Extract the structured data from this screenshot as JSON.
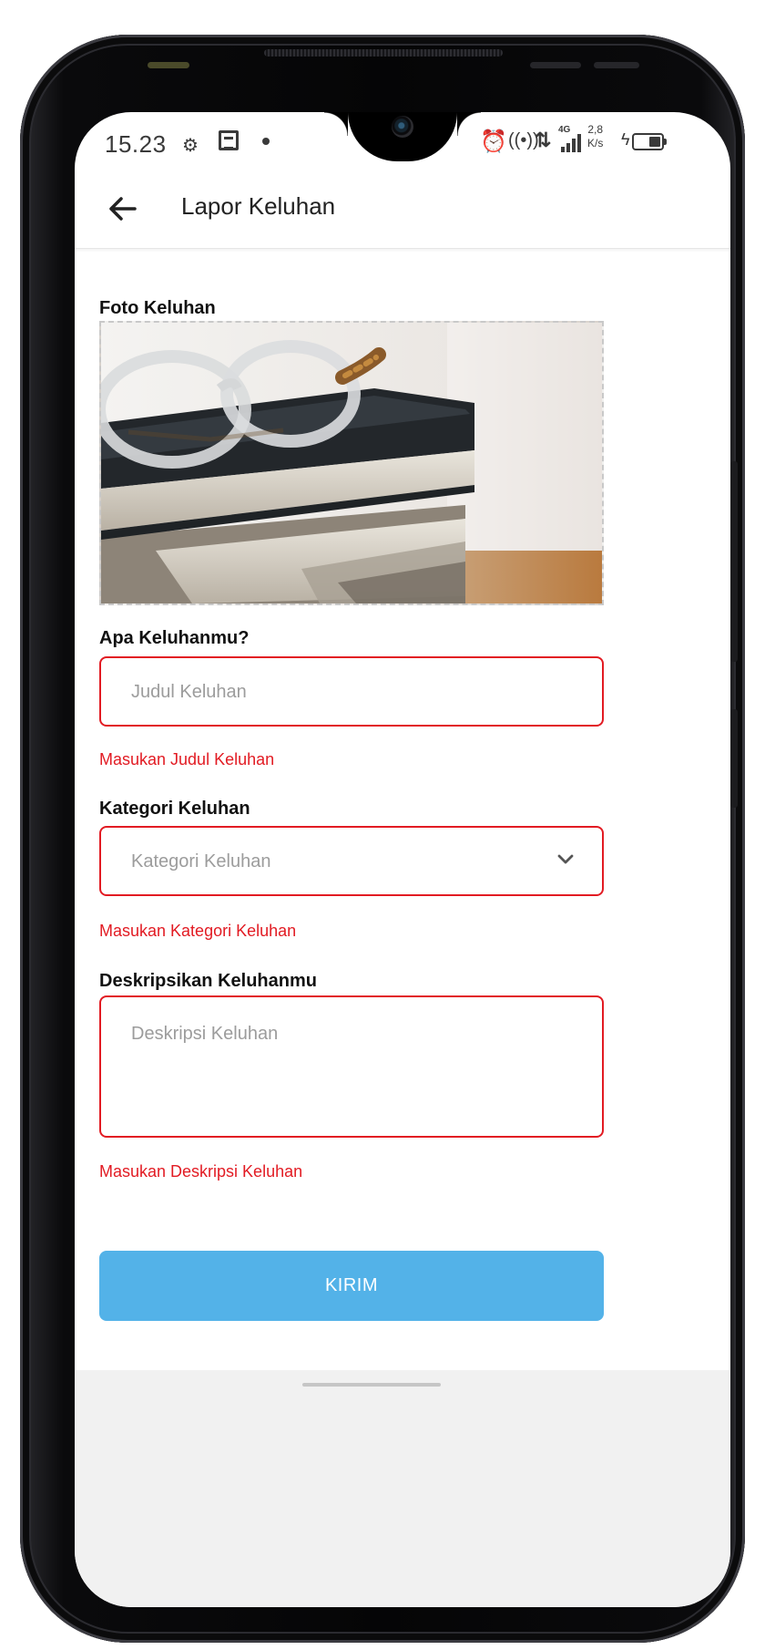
{
  "status_bar": {
    "time": "15.23",
    "network": "4G",
    "speed_value": "2,8",
    "speed_unit": "K/s"
  },
  "header": {
    "title": "Lapor Keluhan"
  },
  "form": {
    "photo": {
      "label": "Foto Keluhan"
    },
    "title_field": {
      "label": "Apa Keluhanmu?",
      "placeholder": "Judul Keluhan",
      "value": "",
      "error": "Masukan Judul Keluhan"
    },
    "category_field": {
      "label": "Kategori Keluhan",
      "placeholder": "Kategori Keluhan",
      "selected": "",
      "error": "Masukan Kategori Keluhan"
    },
    "description_field": {
      "label": "Deskripsikan Keluhanmu",
      "placeholder": "Deskripsi Keluhan",
      "value": "",
      "error": "Masukan Deskripsi Keluhan"
    },
    "submit_label": "KIRIM"
  },
  "colors": {
    "error": "#e21b23",
    "submit": "#53b2e8"
  }
}
